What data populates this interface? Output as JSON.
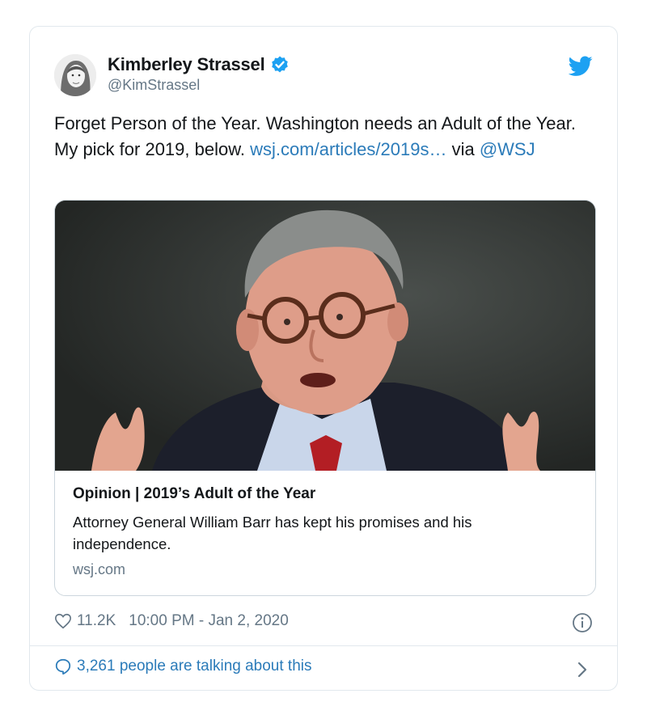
{
  "author": {
    "name": "Kimberley Strassel",
    "handle": "@KimStrassel",
    "verified_icon": "verified-badge-icon"
  },
  "brand_icon": "twitter-bird-icon",
  "tweet": {
    "text": "Forget Person of the Year. Washington needs an Adult of the Year. My pick for 2019, below.",
    "link": "wsj.com/articles/2019s…",
    "via": "via",
    "mention": "@WSJ"
  },
  "card": {
    "title": "Opinion | 2019’s Adult of the Year",
    "description": "Attorney General William Barr has kept his promises and his independence.",
    "domain": "wsj.com",
    "image_icon": "article-photo"
  },
  "meta": {
    "likes": "11.2K",
    "timestamp": "10:00 PM - Jan 2, 2020"
  },
  "footer": {
    "conversation": "3,261 people are talking about this"
  },
  "colors": {
    "link": "#2b7bb9",
    "muted": "#657786",
    "border": "#e1e8ed",
    "brand": "#1da1f2"
  }
}
